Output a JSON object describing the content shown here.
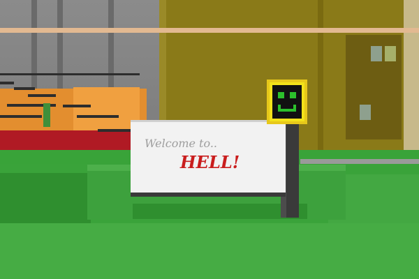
{
  "scene": {
    "sign": {
      "line1": "Welcome to..",
      "line2": "HELL!"
    },
    "smiley_icon": "smiley-face-block",
    "colors": {
      "grass": "#3aa33a",
      "train_orange": "#e38e2f",
      "train_red": "#b01a24",
      "smiley_yellow": "#f2e21a",
      "smiley_green": "#2cc02c",
      "sign_red_text": "#c91d1d"
    }
  }
}
